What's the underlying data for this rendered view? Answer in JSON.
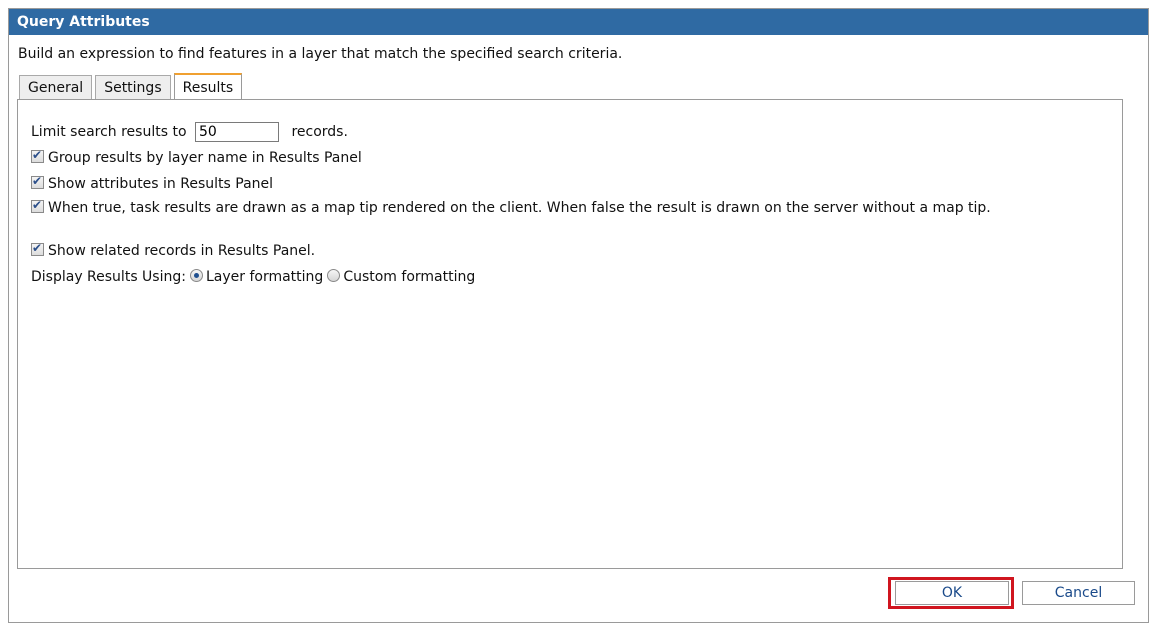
{
  "dialog": {
    "title": "Query Attributes",
    "description": "Build an expression to find features in a layer that match the specified search criteria."
  },
  "tabs": [
    {
      "label": "General",
      "active": false
    },
    {
      "label": "Settings",
      "active": false
    },
    {
      "label": "Results",
      "active": true
    }
  ],
  "results": {
    "limit_prefix": "Limit search results to",
    "limit_value": "50",
    "limit_suffix": "records.",
    "options": [
      {
        "label": "Group results by layer name in Results Panel",
        "checked": true
      },
      {
        "label": "Show attributes in Results Panel",
        "checked": true
      },
      {
        "label": "When true, task results are drawn as a map tip rendered on the client. When false the result is drawn on the server without a map tip.",
        "checked": true
      },
      {
        "label": "Show related records in Results Panel.",
        "checked": true
      }
    ],
    "display_label": "Display Results Using:",
    "display_options": [
      {
        "label": "Layer formatting",
        "selected": true
      },
      {
        "label": "Custom formatting",
        "selected": false
      }
    ]
  },
  "buttons": {
    "ok": "OK",
    "cancel": "Cancel"
  },
  "colors": {
    "title_bar": "#2f6aa3",
    "highlight": "#d0151f",
    "active_tab_accent": "#f0a030"
  }
}
